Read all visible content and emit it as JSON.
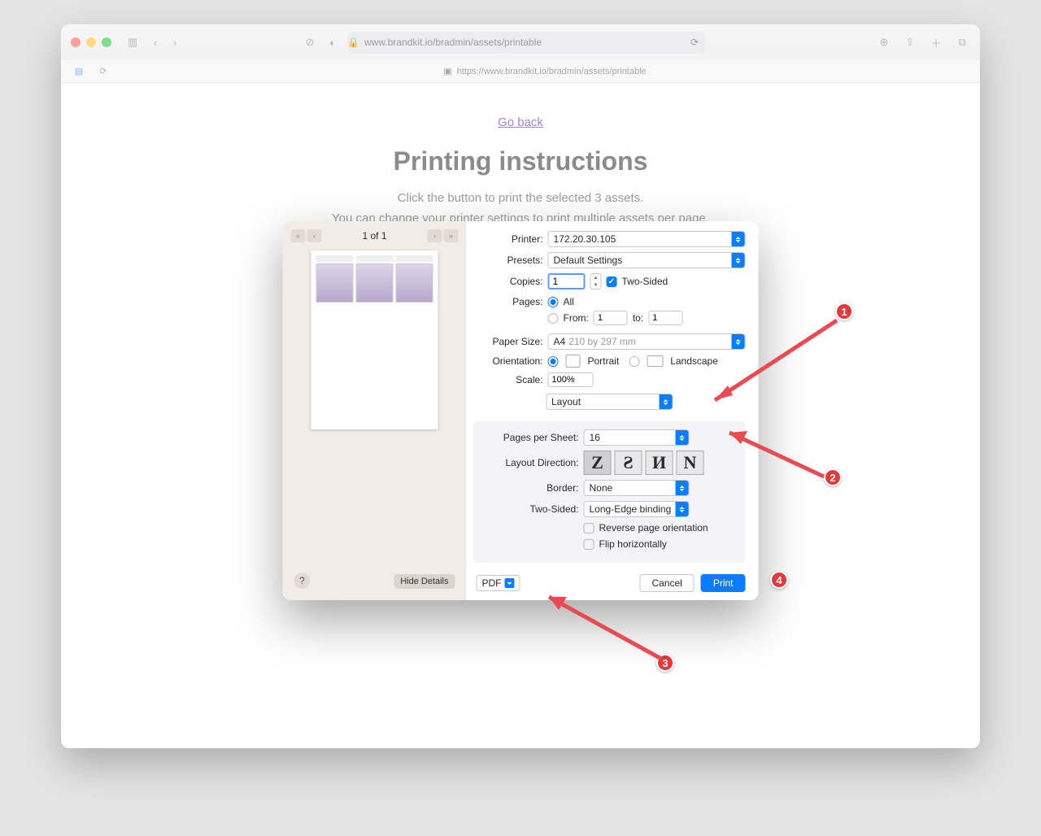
{
  "browser": {
    "address_display": "www.brandkit.io/bradmin/assets/printable",
    "full_url": "https://www.brandkit.io/bradmin/assets/printable"
  },
  "page": {
    "go_back": "Go back",
    "title": "Printing instructions",
    "line1": "Click the button to print the selected 3 assets.",
    "line2": "You can change your printer settings to print multiple assets per page."
  },
  "dialog": {
    "page_indicator": "1 of 1",
    "help": "?",
    "hide_details": "Hide Details",
    "labels": {
      "printer": "Printer:",
      "presets": "Presets:",
      "copies": "Copies:",
      "two_sided_cb": "Two-Sided",
      "pages": "Pages:",
      "all": "All",
      "from": "From:",
      "to": "to:",
      "paper_size": "Paper Size:",
      "orientation": "Orientation:",
      "portrait": "Portrait",
      "landscape": "Landscape",
      "scale": "Scale:",
      "section": "Layout",
      "pages_per_sheet": "Pages per Sheet:",
      "layout_direction": "Layout Direction:",
      "border": "Border:",
      "two_sided": "Two-Sided:",
      "reverse": "Reverse page orientation",
      "flip": "Flip horizontally",
      "pdf": "PDF",
      "cancel": "Cancel",
      "print": "Print"
    },
    "values": {
      "printer": "172.20.30.105",
      "presets": "Default Settings",
      "copies": "1",
      "from": "1",
      "to": "1",
      "paper_size": "A4",
      "paper_dim": "210 by 297 mm",
      "scale": "100%",
      "pages_per_sheet": "16",
      "border": "None",
      "two_sided": "Long-Edge binding"
    }
  },
  "annotations": {
    "m1": "1",
    "m2": "2",
    "m3": "3",
    "m4": "4"
  }
}
